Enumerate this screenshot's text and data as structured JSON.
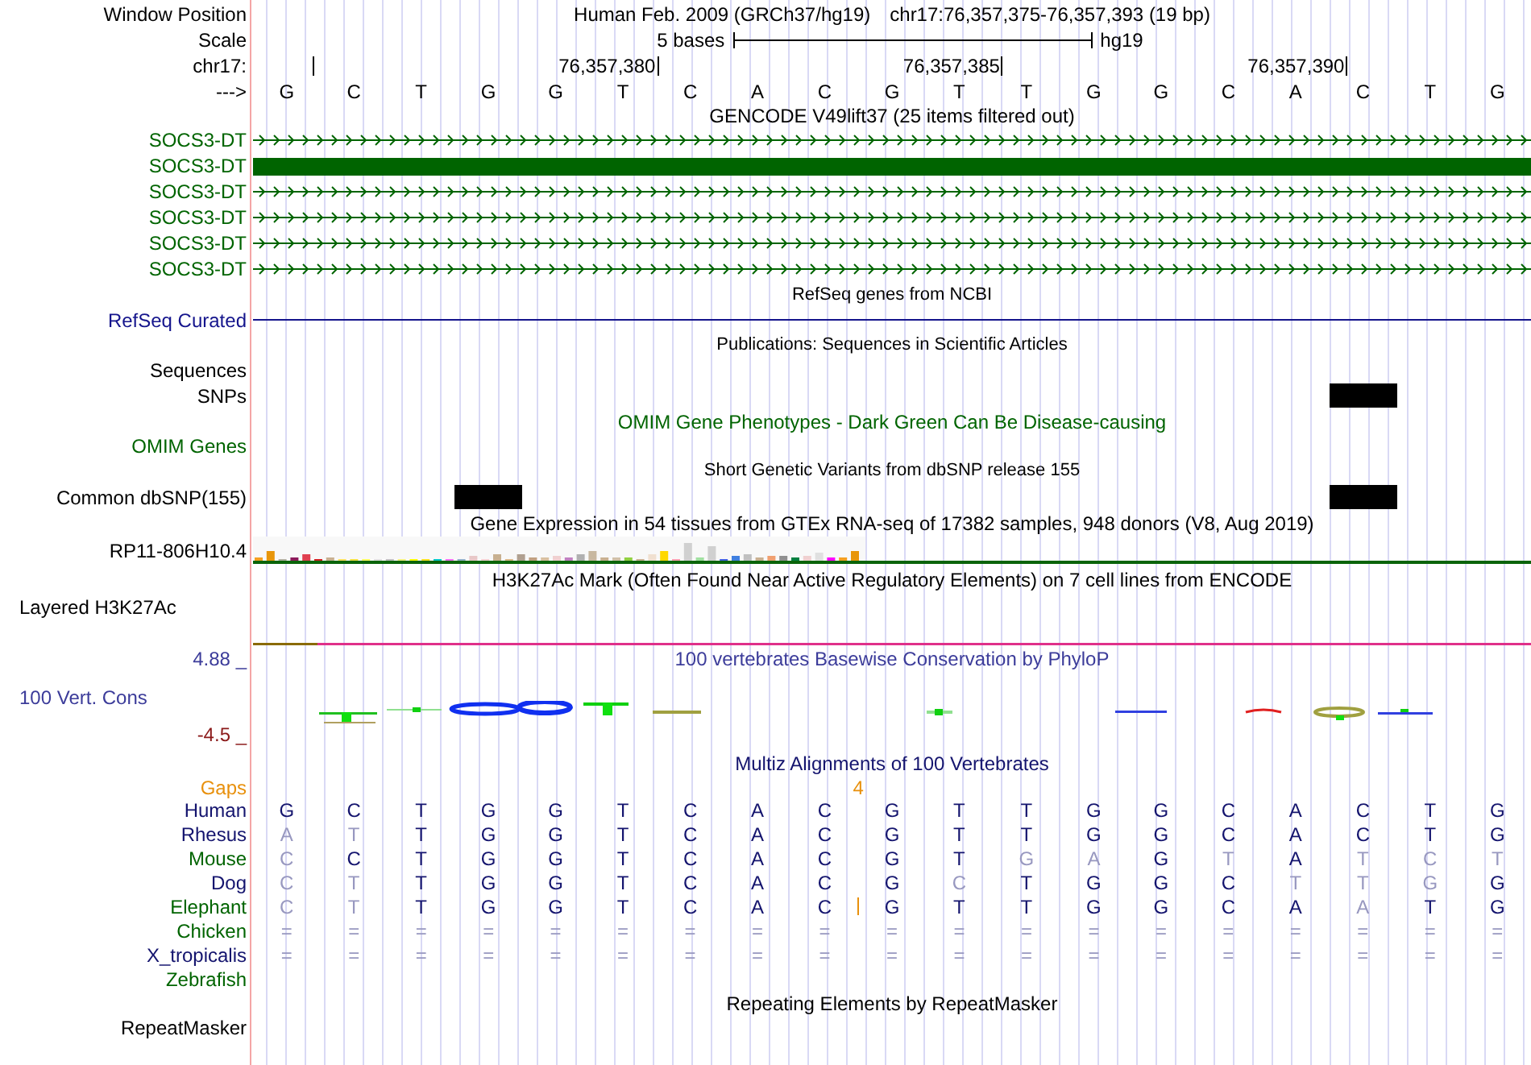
{
  "header": {
    "label": "Window Position",
    "assembly": "Human Feb. 2009 (GRCh37/hg19)",
    "range": "chr17:76,357,375-76,357,393 (19 bp)"
  },
  "scale": {
    "label": "Scale",
    "size": "5 bases",
    "assembly": "hg19"
  },
  "ruler": {
    "label": "chr17:",
    "ticks": [
      "76,357,380",
      "76,357,385",
      "76,357,390"
    ]
  },
  "sequence": {
    "label": "--->",
    "bases": [
      "G",
      "C",
      "T",
      "G",
      "G",
      "T",
      "C",
      "A",
      "C",
      "G",
      "T",
      "T",
      "G",
      "G",
      "C",
      "A",
      "C",
      "T",
      "G"
    ]
  },
  "tracks": [
    {
      "kind": "genes",
      "title": "GENCODE V49lift37 (25 items filtered out)",
      "color": "#006400",
      "items": [
        {
          "label": "SOCS3-DT",
          "kind": "intron"
        },
        {
          "label": "SOCS3-DT",
          "kind": "exon"
        },
        {
          "label": "SOCS3-DT",
          "kind": "intron"
        },
        {
          "label": "SOCS3-DT",
          "kind": "intron"
        },
        {
          "label": "SOCS3-DT",
          "kind": "intron"
        },
        {
          "label": "SOCS3-DT",
          "kind": "intron"
        }
      ]
    },
    {
      "kind": "line",
      "title": "RefSeq genes from NCBI",
      "label": "RefSeq Curated",
      "color": "#14148c"
    },
    {
      "kind": "features",
      "title": "Publications: Sequences in Scientific Articles",
      "color": "#000000",
      "rows": [
        {
          "label": "Sequences",
          "hits": [
            false,
            false,
            false,
            false,
            false,
            false,
            false,
            false,
            false,
            false,
            false,
            false,
            false,
            false,
            false,
            false,
            false,
            false,
            false
          ]
        },
        {
          "label": "SNPs",
          "hits": [
            false,
            false,
            false,
            false,
            false,
            false,
            false,
            false,
            false,
            false,
            false,
            false,
            false,
            false,
            false,
            false,
            true,
            false,
            false
          ]
        }
      ]
    },
    {
      "kind": "plain",
      "title": "OMIM Gene Phenotypes - Dark Green Can Be Disease-causing",
      "label": "OMIM Genes",
      "color": "#006400"
    },
    {
      "kind": "features",
      "title": "Short Genetic Variants from dbSNP release 155",
      "color": "#000000",
      "rows": [
        {
          "label": "Common dbSNP(155)",
          "hits": [
            false,
            false,
            false,
            true,
            false,
            false,
            false,
            false,
            false,
            false,
            false,
            false,
            false,
            false,
            false,
            false,
            true,
            false,
            false
          ]
        }
      ]
    },
    {
      "kind": "expression",
      "title": "Gene Expression in 54 tissues from GTEx RNA-seq of 17382 samples, 948 donors (V8, Aug 2019)",
      "label": "RP11-806H10.4",
      "color": "#000000"
    },
    {
      "kind": "layered",
      "title": "H3K27Ac Mark (Often Found Near Active Regulatory Elements) on 7 cell lines from ENCODE",
      "label": "Layered H3K27Ac",
      "color": "#000000"
    },
    {
      "kind": "wiggle",
      "title": "100 vertebrates Basewise Conservation by PhyloP",
      "label": "100 Vert. Cons",
      "ymax": "4.88 _",
      "ymin": "-4.5 _",
      "color": "#3c3c9a"
    },
    {
      "kind": "alignment",
      "title": "Multiz Alignments of 100 Vertebrates",
      "color": "#14146e",
      "gaps": {
        "label": "Gaps",
        "count": "4"
      },
      "species": [
        {
          "name": "Human",
          "color": "#14146e",
          "bases": [
            "G",
            "C",
            "T",
            "G",
            "G",
            "T",
            "C",
            "A",
            "C",
            "G",
            "T",
            "T",
            "G",
            "G",
            "C",
            "A",
            "C",
            "T",
            "G"
          ],
          "faded": [
            false,
            false,
            false,
            false,
            false,
            false,
            false,
            false,
            false,
            false,
            false,
            false,
            false,
            false,
            false,
            false,
            false,
            false,
            false
          ]
        },
        {
          "name": "Rhesus",
          "color": "#14146e",
          "bases": [
            "A",
            "T",
            "T",
            "G",
            "G",
            "T",
            "C",
            "A",
            "C",
            "G",
            "T",
            "T",
            "G",
            "G",
            "C",
            "A",
            "C",
            "T",
            "G"
          ],
          "faded": [
            true,
            true,
            false,
            false,
            false,
            false,
            false,
            false,
            false,
            false,
            false,
            false,
            false,
            false,
            false,
            false,
            false,
            false,
            false
          ]
        },
        {
          "name": "Mouse",
          "color": "#006400",
          "bases": [
            "C",
            "C",
            "T",
            "G",
            "G",
            "T",
            "C",
            "A",
            "C",
            "G",
            "T",
            "G",
            "A",
            "G",
            "T",
            "A",
            "T",
            "C",
            "T"
          ],
          "faded": [
            true,
            false,
            false,
            false,
            false,
            false,
            false,
            false,
            false,
            false,
            false,
            true,
            true,
            false,
            true,
            false,
            true,
            true,
            true
          ]
        },
        {
          "name": "Dog",
          "color": "#14146e",
          "bases": [
            "C",
            "T",
            "T",
            "G",
            "G",
            "T",
            "C",
            "A",
            "C",
            "G",
            "C",
            "T",
            "G",
            "G",
            "C",
            "T",
            "T",
            "G",
            "G"
          ],
          "faded": [
            true,
            true,
            false,
            false,
            false,
            false,
            false,
            false,
            false,
            false,
            true,
            false,
            false,
            false,
            false,
            true,
            true,
            true,
            false
          ]
        },
        {
          "name": "Elephant",
          "color": "#006400",
          "bases": [
            "C",
            "T",
            "T",
            "G",
            "G",
            "T",
            "C",
            "A",
            "C",
            "G",
            "T",
            "T",
            "G",
            "G",
            "C",
            "A",
            "A",
            "T",
            "G"
          ],
          "faded": [
            true,
            true,
            false,
            false,
            false,
            false,
            false,
            false,
            false,
            false,
            false,
            false,
            false,
            false,
            false,
            false,
            true,
            false,
            false
          ],
          "insert_before": [
            false,
            false,
            false,
            false,
            false,
            false,
            false,
            false,
            false,
            true,
            false,
            false,
            false,
            false,
            false,
            false,
            false,
            false,
            false
          ]
        },
        {
          "name": "Chicken",
          "color": "#006400",
          "bases": [
            "=",
            "=",
            "=",
            "=",
            "=",
            "=",
            "=",
            "=",
            "=",
            "=",
            "=",
            "=",
            "=",
            "=",
            "=",
            "=",
            "=",
            "=",
            "="
          ],
          "faded": [
            true,
            true,
            true,
            true,
            true,
            true,
            true,
            true,
            true,
            true,
            true,
            true,
            true,
            true,
            true,
            true,
            true,
            true,
            true
          ]
        },
        {
          "name": "X_tropicalis",
          "color": "#14146e",
          "bases": [
            "=",
            "=",
            "=",
            "=",
            "=",
            "=",
            "=",
            "=",
            "=",
            "=",
            "=",
            "=",
            "=",
            "=",
            "=",
            "=",
            "=",
            "=",
            "="
          ],
          "faded": [
            true,
            true,
            true,
            true,
            true,
            true,
            true,
            true,
            true,
            true,
            true,
            true,
            true,
            true,
            true,
            true,
            true,
            true,
            true
          ]
        },
        {
          "name": "Zebrafish",
          "color": "#006400"
        }
      ]
    },
    {
      "kind": "plain",
      "title": "Repeating Elements by RepeatMasker",
      "label": "RepeatMasker",
      "color": "#000000"
    }
  ]
}
